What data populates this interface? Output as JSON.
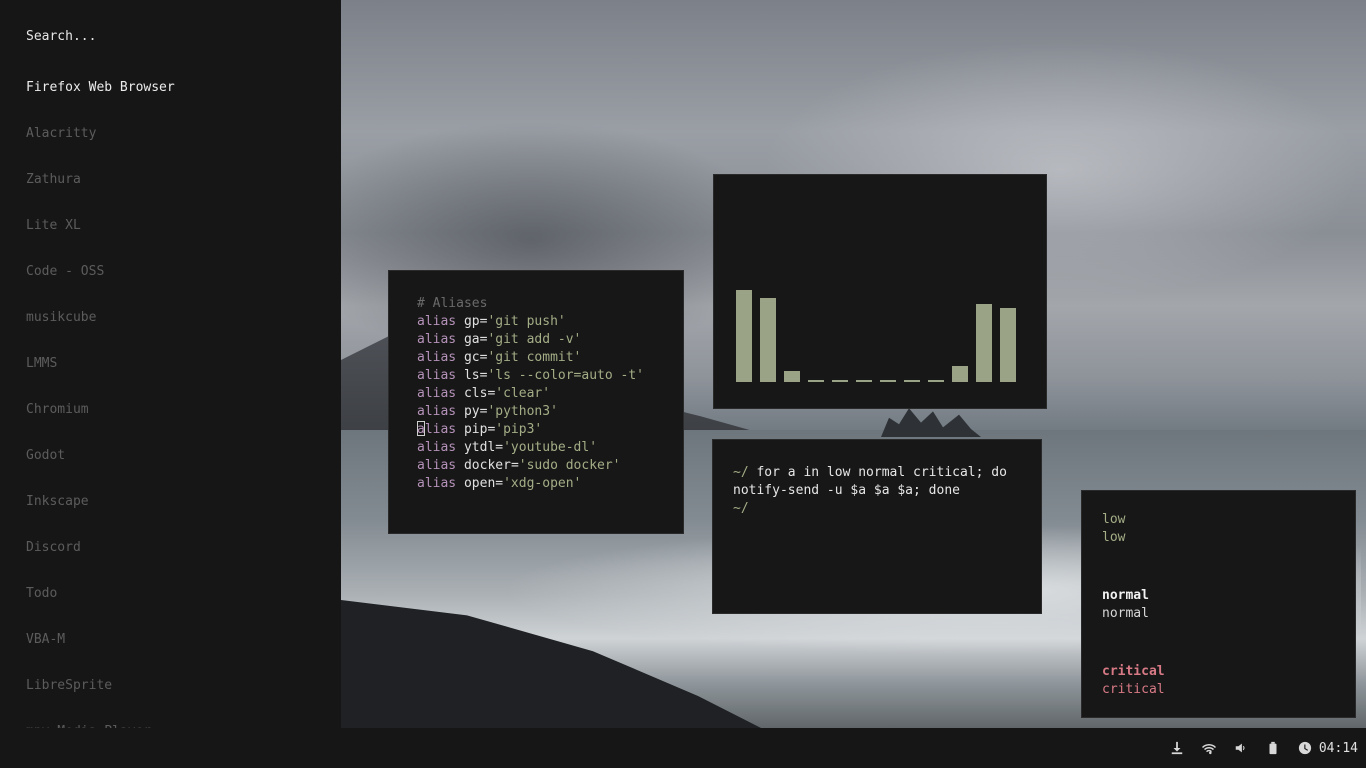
{
  "launcher": {
    "search_placeholder": "Search...",
    "apps": [
      "Firefox Web Browser",
      "Alacritty",
      "Zathura",
      "Lite XL",
      "Code - OSS",
      "musikcube",
      "LMMS",
      "Chromium",
      "Godot",
      "Inkscape",
      "Discord",
      "Todo",
      "VBA-M",
      "LibreSprite",
      "mpv Media Player"
    ],
    "selected_index": 0
  },
  "aliases_terminal": {
    "comment": "# Aliases",
    "lines": [
      {
        "kw": "alias",
        "name": "gp",
        "eq": "=",
        "value": "'git push'"
      },
      {
        "kw": "alias",
        "name": "ga",
        "eq": "=",
        "value": "'git add -v'"
      },
      {
        "kw": "alias",
        "name": "gc",
        "eq": "=",
        "value": "'git commit'"
      },
      {
        "kw": "alias",
        "name": "ls",
        "eq": "=",
        "value": "'ls --color=auto -t'"
      },
      {
        "kw": "alias",
        "name": "cls",
        "eq": "=",
        "value": "'clear'"
      },
      {
        "kw": "alias",
        "name": "py",
        "eq": "=",
        "value": "'python3'"
      },
      {
        "kw": "alias",
        "name": "pip",
        "eq": "=",
        "value": "'pip3'"
      },
      {
        "kw": "alias",
        "name": "ytdl",
        "eq": "=",
        "value": "'youtube-dl'"
      },
      {
        "kw": "alias",
        "name": "docker",
        "eq": "=",
        "value": "'sudo docker'"
      },
      {
        "kw": "alias",
        "name": "open",
        "eq": "=",
        "value": "'xdg-open'"
      }
    ],
    "cursor_line": 6
  },
  "visualizer": {
    "levels": [
      0.98,
      0.89,
      0.12,
      0.02,
      0.02,
      0.02,
      0.02,
      0.02,
      0.02,
      0.17,
      0.83,
      0.79
    ],
    "bar_color": "#9aa386"
  },
  "shell_terminal": {
    "prompt": "~/",
    "command_line1": " for a in low normal critical; do",
    "command_line2": "notify-send -u $a $a $a; done",
    "prompt2": "~/"
  },
  "notifications": [
    {
      "urgency": "low",
      "summary": "low",
      "body": "low"
    },
    {
      "urgency": "normal",
      "summary": "normal",
      "body": "normal"
    },
    {
      "urgency": "critical",
      "summary": "critical",
      "body": "critical"
    }
  ],
  "tray": {
    "icons": [
      "download-icon",
      "wifi-icon",
      "volume-icon",
      "battery-icon",
      "clock-icon"
    ],
    "time": "04:14"
  }
}
